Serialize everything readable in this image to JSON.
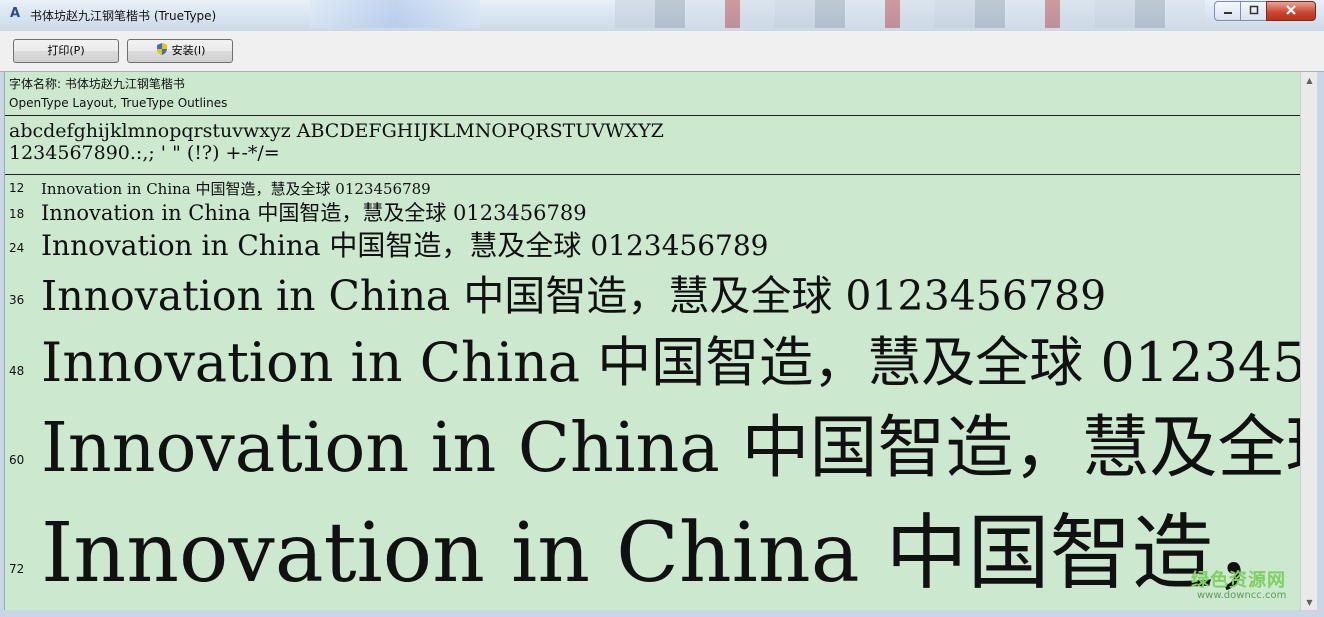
{
  "window": {
    "title": "书体坊赵九江钢笔楷书 (TrueType)",
    "icon": "font-viewer-icon",
    "controls": {
      "minimize": "0",
      "maximize": "1",
      "close": "r"
    }
  },
  "toolbar": {
    "print_label": "打印(P)",
    "install_label": "安装(I)"
  },
  "font_info": {
    "name_line": "字体名称: 书体坊赵九江钢笔楷书",
    "type_line": "OpenType Layout, TrueType Outlines"
  },
  "charset": {
    "line1": "abcdefghijklmnopqrstuvwxyz ABCDEFGHIJKLMNOPQRSTUVWXYZ",
    "line2": "1234567890.:,; ' \" (!?) +-*/="
  },
  "sample_text": "Innovation in China 中国智造，慧及全球 0123456789",
  "sizes": [
    "12",
    "18",
    "24",
    "36",
    "48",
    "60",
    "72"
  ],
  "watermark": {
    "line1": "绿色资源网",
    "line2": "www.downcc.com"
  },
  "colors": {
    "preview_bg": "#cce8cf",
    "frame": "#c9d6e6",
    "close_button": "#c9432d"
  }
}
